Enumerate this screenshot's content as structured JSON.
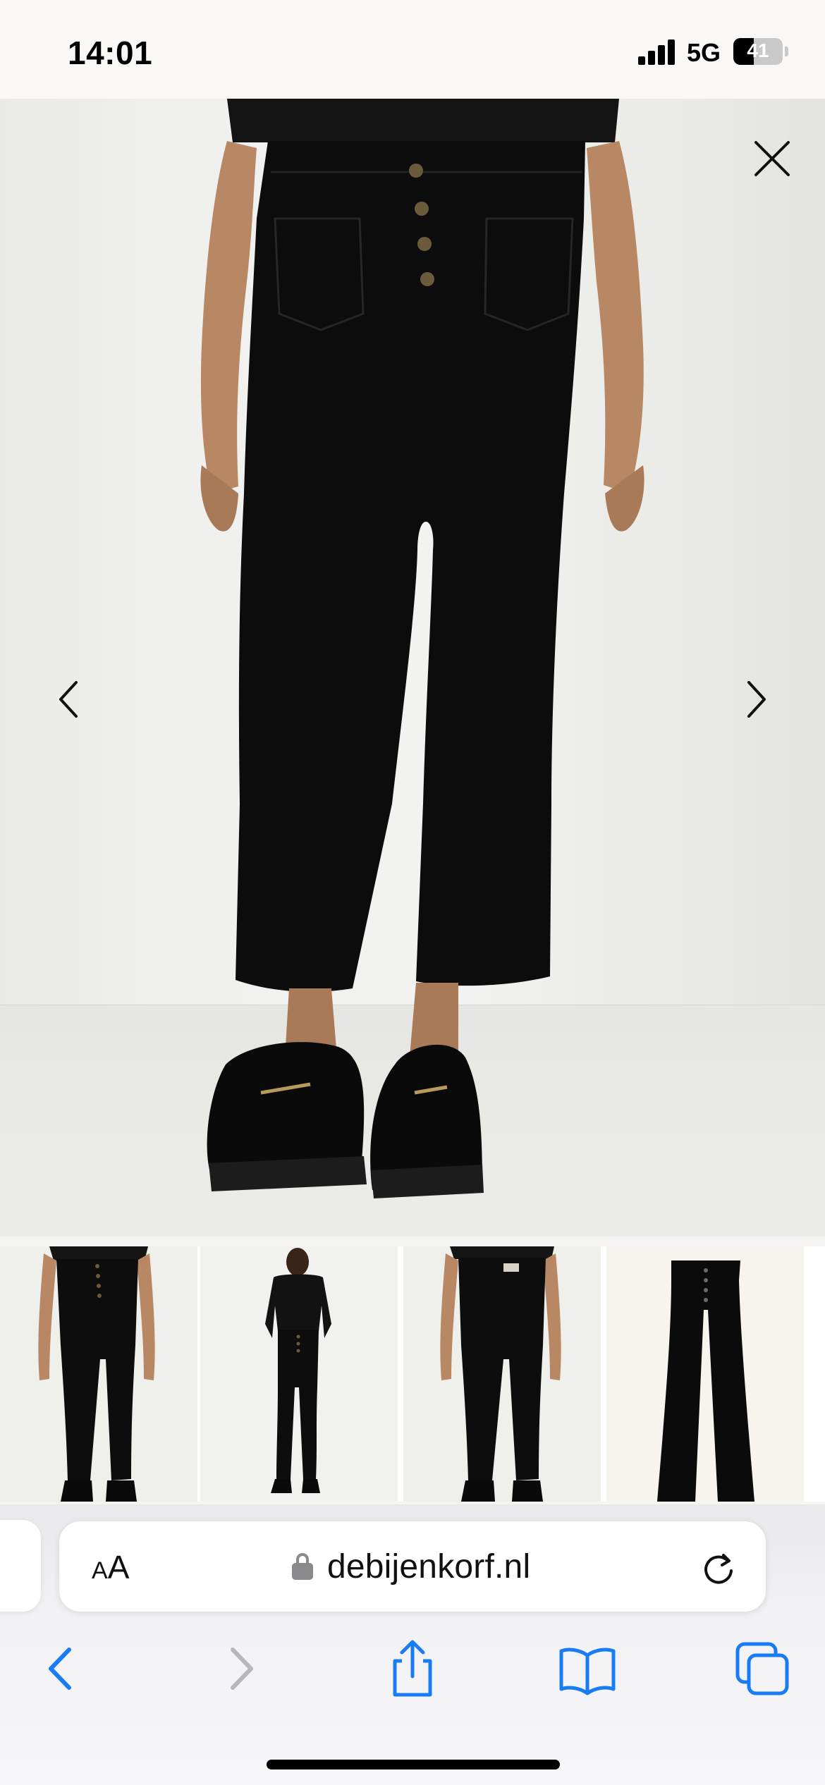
{
  "status_bar": {
    "time": "14:01",
    "network": "5G",
    "battery_percent": "41",
    "battery_level": 0.41
  },
  "gallery": {
    "main_image_alt": "",
    "thumbnail_count": 4,
    "icons": {
      "close": "close-icon",
      "previous": "chevron-left-icon",
      "next": "chevron-right-icon"
    }
  },
  "browser": {
    "text_size_label_small": "A",
    "text_size_label_large": "A",
    "url": "debijenkorf.nl",
    "icons": [
      "lock-icon",
      "reload-icon",
      "back-icon",
      "forward-icon",
      "share-icon",
      "bookmarks-icon",
      "tabs-icon"
    ],
    "accent_color": "#1a7cf2",
    "disabled_color": "#b7b7bb"
  }
}
